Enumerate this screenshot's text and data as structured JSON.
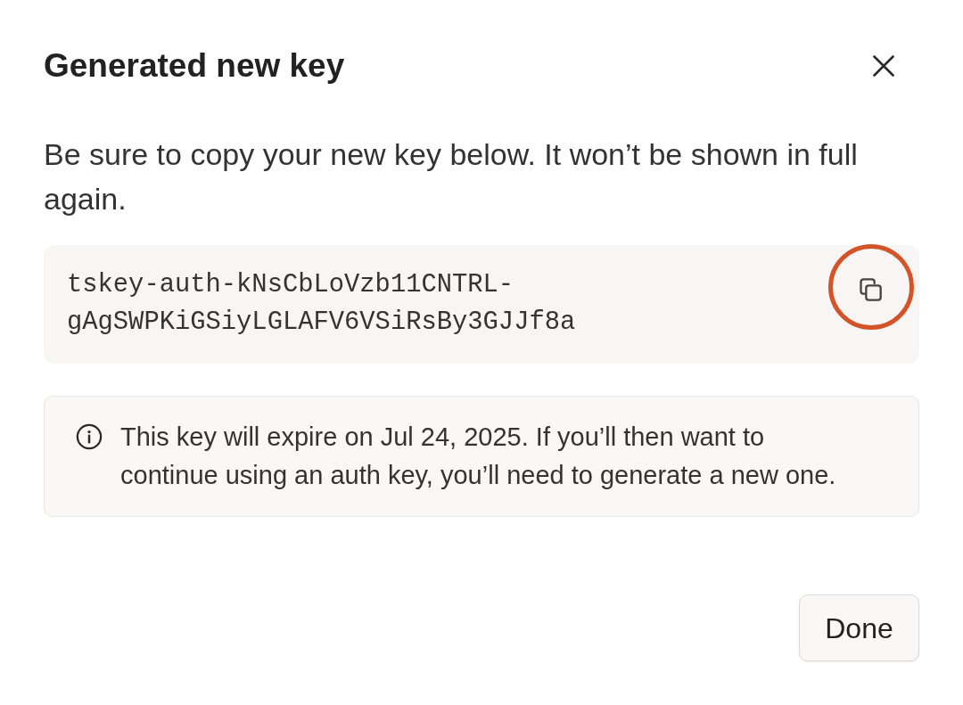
{
  "dialog": {
    "title": "Generated new key",
    "message": "Be sure to copy your new key below. It won’t be shown in full again.",
    "key": {
      "value": "tskey-auth-kNsCbLoVzb11CNTRL-gAgSWPKiGSiyLGLAFV6VSiRsBy3GJJf8a",
      "copy_highlighted": true
    },
    "notice": {
      "kind": "info",
      "text": "This key will expire on Jul 24, 2025. If you’ll then want to continue using an auth key, you’ll need to generate a new one."
    },
    "buttons": [
      {
        "label": "Done"
      }
    ]
  }
}
